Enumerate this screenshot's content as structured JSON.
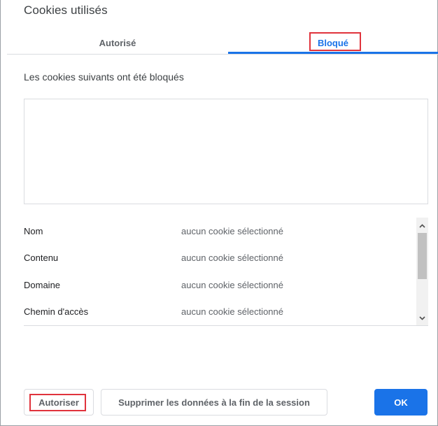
{
  "dialog": {
    "title": "Cookies utilisés"
  },
  "tabs": [
    {
      "label": "Autorisé",
      "selected": false
    },
    {
      "label": "Bloqué",
      "selected": true
    }
  ],
  "description": "Les cookies suivants ont été bloqués",
  "details": [
    {
      "label": "Nom",
      "value": "aucun cookie sélectionné"
    },
    {
      "label": "Contenu",
      "value": "aucun cookie sélectionné"
    },
    {
      "label": "Domaine",
      "value": "aucun cookie sélectionné"
    },
    {
      "label": "Chemin d'accès",
      "value": "aucun cookie sélectionné"
    }
  ],
  "buttons": {
    "allow": "Autoriser",
    "clear_on_exit": "Supprimer les données à la fin de la session",
    "ok": "OK"
  },
  "colors": {
    "accent": "#1a73e8",
    "highlight": "#e0333c"
  }
}
